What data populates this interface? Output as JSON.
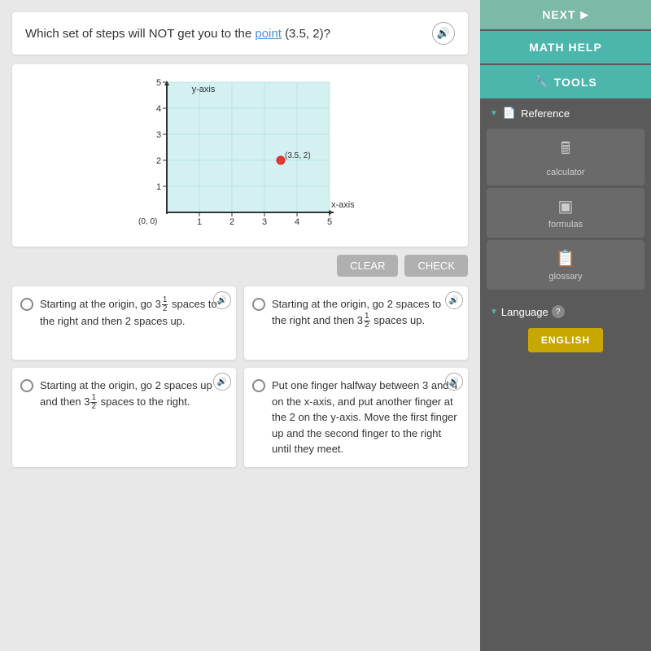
{
  "header": {
    "question": "Which set of steps will NOT get you to the",
    "point_text": "point",
    "coordinates": "(3.5, 2)?",
    "volume_icon": "🔊"
  },
  "graph": {
    "y_axis_label": "y-axis",
    "x_axis_label": "x-axis",
    "origin_label": "(0, 0)",
    "point_label": "(3.5, 2)",
    "x_ticks": [
      "1",
      "2",
      "3",
      "4",
      "5"
    ],
    "y_ticks": [
      "1",
      "2",
      "3",
      "4",
      "5"
    ]
  },
  "buttons": {
    "clear": "CLEAR",
    "check": "CHECK"
  },
  "options": [
    {
      "id": "A",
      "text_parts": [
        "Starting at the origin, go 3½ spaces to the right and then 2 spaces up."
      ]
    },
    {
      "id": "B",
      "text_parts": [
        "Starting at the origin, go 2 spaces to the right and then 3½ spaces up."
      ]
    },
    {
      "id": "C",
      "text_parts": [
        "Starting at the origin, go 2 spaces up and then 3½ spaces to the right."
      ]
    },
    {
      "id": "D",
      "text_parts": [
        "Put one finger halfway between 3 and 4 on the x-axis, and put another finger at the 2 on the y-axis. Move the first finger up and the second finger to the right until they meet."
      ]
    }
  ],
  "sidebar": {
    "next_label": "NEXT",
    "math_help_label": "MATH HELP",
    "tools_label": "TOOLS",
    "reference_label": "Reference",
    "calculator_label": "calculator",
    "formulas_label": "formulas",
    "glossary_label": "glossary",
    "language_label": "Language",
    "english_label": "ENGLISH"
  }
}
